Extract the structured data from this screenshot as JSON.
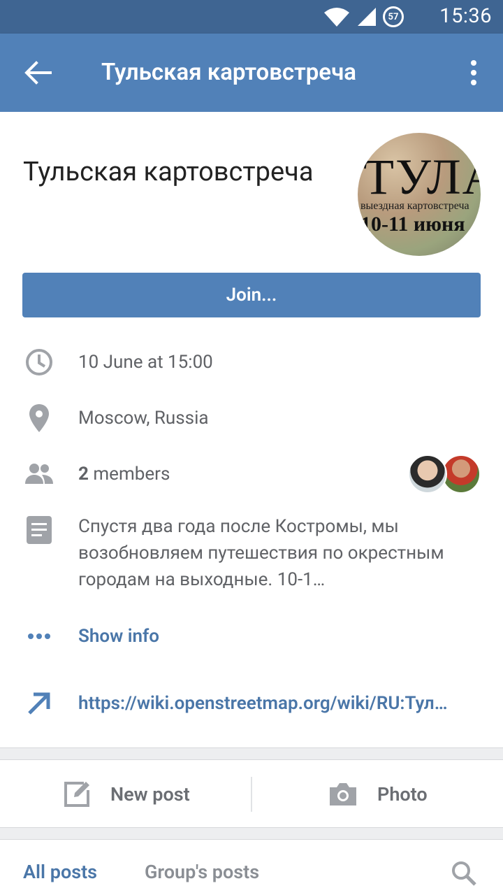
{
  "status_bar": {
    "time": "15:36",
    "battery_percent": "57"
  },
  "toolbar": {
    "title": "Тульская картовстреча"
  },
  "group": {
    "name": "Тульская картовстреча",
    "avatar_text_line1": "ТУЛА",
    "avatar_text_line2": "выездная картовстреча",
    "avatar_text_line3": "10-11 июня"
  },
  "join_button": "Join...",
  "info": {
    "date": "10 June at 15:00",
    "location": "Moscow, Russia",
    "members_count": "2",
    "members_label": " members",
    "description": "Спустя два года после Костромы, мы возобновляем путешествия по окрестным городам на выходные. 10-1…",
    "show_info": "Show info",
    "link": "https://wiki.openstreetmap.org/wiki/RU:Тул…"
  },
  "actions": {
    "new_post": "New post",
    "photo": "Photo"
  },
  "tabs": {
    "all_posts": "All posts",
    "groups_posts": "Group's posts"
  },
  "colors": {
    "accent": "#5181b8",
    "link": "#4a76a8",
    "status_bar": "#3f6592"
  },
  "icons": [
    "wifi-icon",
    "signal-icon",
    "battery-icon",
    "back-arrow-icon",
    "more-vert-icon",
    "clock-icon",
    "location-pin-icon",
    "members-icon",
    "description-icon",
    "dots-icon",
    "external-link-icon",
    "edit-icon",
    "camera-icon",
    "search-icon"
  ]
}
